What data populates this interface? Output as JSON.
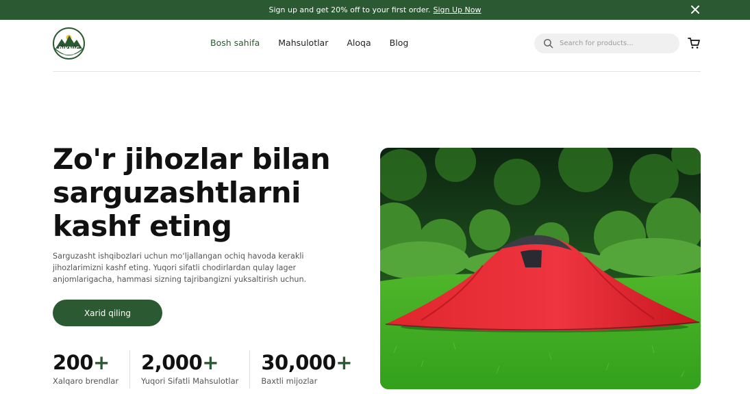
{
  "banner": {
    "text": "Sign up and get 20% off to your first order.",
    "link": "Sign Up Now"
  },
  "logo": {
    "text": "PIKNIC",
    "subtext": "UZBEKISTAN"
  },
  "nav": {
    "items": [
      {
        "label": "Bosh sahifa",
        "active": true
      },
      {
        "label": "Mahsulotlar",
        "active": false
      },
      {
        "label": "Aloqa",
        "active": false
      },
      {
        "label": "Blog",
        "active": false
      }
    ]
  },
  "search": {
    "placeholder": "Search for products..."
  },
  "hero": {
    "headline_line1": "Zo'r jihozlar bilan",
    "headline_line2": "sarguzashtlarni",
    "headline_line3": "kashf eting",
    "description": "Sarguzasht ishqibozlari uchun mo‘ljallangan ochiq havoda kerakli jihozlarimizni kashf eting. Yuqori sifatli chodirlardan qulay lager anjomlarigacha, hammasi sizning tajribangizni yuksaltirish uchun.",
    "cta_label": "Xarid qiling"
  },
  "stats": [
    {
      "value": "200",
      "suffix": "+",
      "label": "Xalqaro brendlar"
    },
    {
      "value": "2,000",
      "suffix": "+",
      "label": "Yuqori Sifatli Mahsulotlar"
    },
    {
      "value": "30,000",
      "suffix": "+",
      "label": "Baxtli mijozlar"
    }
  ],
  "colors": {
    "brand": "#2b5a32",
    "accent_yellow": "#f2c230"
  },
  "icons": {
    "close": "close-icon",
    "search": "search-icon",
    "cart": "cart-icon"
  }
}
